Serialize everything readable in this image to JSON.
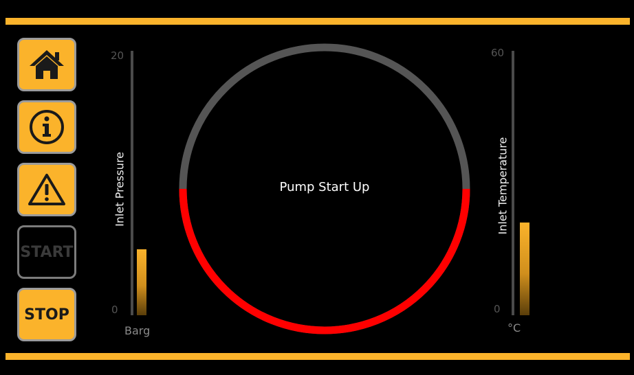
{
  "sidebar": {
    "home": {
      "icon": "home-icon"
    },
    "info": {
      "icon": "info-icon"
    },
    "alarm": {
      "icon": "warning-icon"
    },
    "start": {
      "label": "START",
      "enabled": false
    },
    "stop": {
      "label": "STOP",
      "enabled": true
    }
  },
  "pressure": {
    "label": "Inlet Pressure",
    "unit": "Barg",
    "max_label": "20",
    "min_label": "0",
    "min": 0,
    "max": 20,
    "value": 5
  },
  "temperature": {
    "label": "Inlet Temperature",
    "unit": "°C",
    "max_label": "60",
    "min_label": "0",
    "min": 0,
    "max": 60,
    "value": 21
  },
  "pump": {
    "status_text": "Pump Start Up",
    "progress": 0.5
  },
  "colors": {
    "accent": "#fbb32b",
    "ring_track": "#555555",
    "ring_progress": "#ff0000",
    "background": "#000000"
  }
}
